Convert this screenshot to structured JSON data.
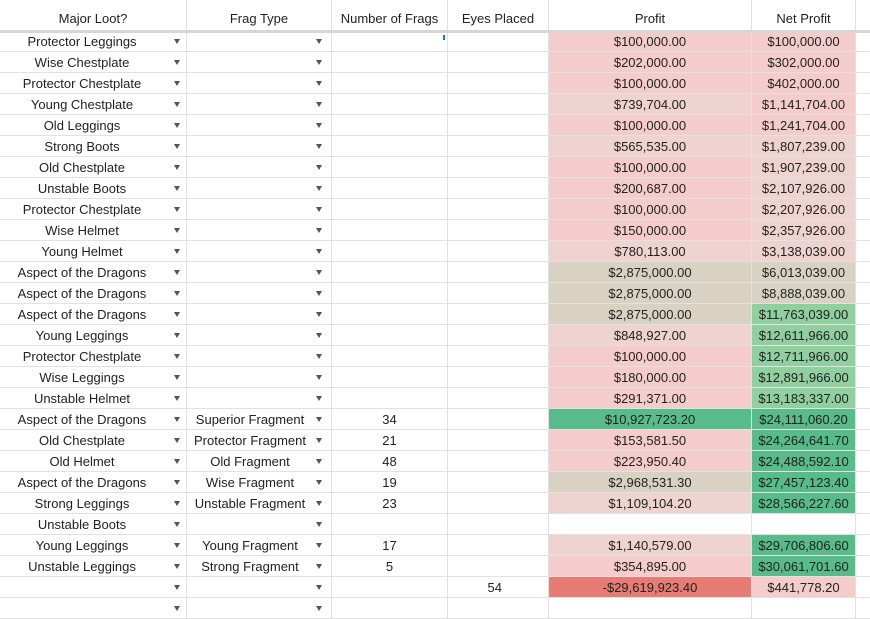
{
  "colors": {
    "pink": "#f4cccc",
    "olive": "#d9d2c3",
    "green": "#57bb8a",
    "red": "#e67c73",
    "white": "#ffffff",
    "pink_light": "#efd3d0"
  },
  "headers": {
    "major_loot": "Major Loot?",
    "frag_type": "Frag Type",
    "num_frags": "Number of Frags",
    "eyes_placed": "Eyes Placed",
    "profit": "Profit",
    "net_profit": "Net Profit"
  },
  "rows": [
    {
      "loot": "Protector Leggings",
      "frag": "",
      "num": "",
      "eyes": "",
      "profit": "$100,000.00",
      "profit_color": "pink",
      "net": "$100,000.00",
      "net_color": "pink"
    },
    {
      "loot": "Wise Chestplate",
      "frag": "",
      "num": "",
      "eyes": "",
      "profit": "$202,000.00",
      "profit_color": "pink",
      "net": "$302,000.00",
      "net_color": "pink"
    },
    {
      "loot": "Protector Chestplate",
      "frag": "",
      "num": "",
      "eyes": "",
      "profit": "$100,000.00",
      "profit_color": "pink",
      "net": "$402,000.00",
      "net_color": "pink"
    },
    {
      "loot": "Young Chestplate",
      "frag": "",
      "num": "",
      "eyes": "",
      "profit": "$739,704.00",
      "profit_color": "pink_light",
      "net": "$1,141,704.00",
      "net_color": "pink"
    },
    {
      "loot": "Old Leggings",
      "frag": "",
      "num": "",
      "eyes": "",
      "profit": "$100,000.00",
      "profit_color": "pink",
      "net": "$1,241,704.00",
      "net_color": "pink"
    },
    {
      "loot": "Strong Boots",
      "frag": "",
      "num": "",
      "eyes": "",
      "profit": "$565,535.00",
      "profit_color": "pink_light",
      "net": "$1,807,239.00",
      "net_color": "pink_light"
    },
    {
      "loot": "Old Chestplate",
      "frag": "",
      "num": "",
      "eyes": "",
      "profit": "$100,000.00",
      "profit_color": "pink",
      "net": "$1,907,239.00",
      "net_color": "pink_light"
    },
    {
      "loot": "Unstable Boots",
      "frag": "",
      "num": "",
      "eyes": "",
      "profit": "$200,687.00",
      "profit_color": "pink",
      "net": "$2,107,926.00",
      "net_color": "pink_light"
    },
    {
      "loot": "Protector Chestplate",
      "frag": "",
      "num": "",
      "eyes": "",
      "profit": "$100,000.00",
      "profit_color": "pink",
      "net": "$2,207,926.00",
      "net_color": "pink_light"
    },
    {
      "loot": "Wise Helmet",
      "frag": "",
      "num": "",
      "eyes": "",
      "profit": "$150,000.00",
      "profit_color": "pink",
      "net": "$2,357,926.00",
      "net_color": "pink_light"
    },
    {
      "loot": "Young Helmet",
      "frag": "",
      "num": "",
      "eyes": "",
      "profit": "$780,113.00",
      "profit_color": "pink_light",
      "net": "$3,138,039.00",
      "net_color": "pink_light"
    },
    {
      "loot": "Aspect of the Dragons",
      "frag": "",
      "num": "",
      "eyes": "",
      "profit": "$2,875,000.00",
      "profit_color": "olive",
      "net": "$6,013,039.00",
      "net_color": "olive"
    },
    {
      "loot": "Aspect of the Dragons",
      "frag": "",
      "num": "",
      "eyes": "",
      "profit": "$2,875,000.00",
      "profit_color": "olive",
      "net": "$8,888,039.00",
      "net_color": "olive"
    },
    {
      "loot": "Aspect of the Dragons",
      "frag": "",
      "num": "",
      "eyes": "",
      "profit": "$2,875,000.00",
      "profit_color": "olive",
      "net": "$11,763,039.00",
      "net_color": "green_soft"
    },
    {
      "loot": "Young Leggings",
      "frag": "",
      "num": "",
      "eyes": "",
      "profit": "$848,927.00",
      "profit_color": "pink_light",
      "net": "$12,611,966.00",
      "net_color": "green_soft"
    },
    {
      "loot": "Protector Chestplate",
      "frag": "",
      "num": "",
      "eyes": "",
      "profit": "$100,000.00",
      "profit_color": "pink",
      "net": "$12,711,966.00",
      "net_color": "green_soft"
    },
    {
      "loot": "Wise Leggings",
      "frag": "",
      "num": "",
      "eyes": "",
      "profit": "$180,000.00",
      "profit_color": "pink",
      "net": "$12,891,966.00",
      "net_color": "green_soft"
    },
    {
      "loot": "Unstable Helmet",
      "frag": "",
      "num": "",
      "eyes": "",
      "profit": "$291,371.00",
      "profit_color": "pink",
      "net": "$13,183,337.00",
      "net_color": "green_soft"
    },
    {
      "loot": "Aspect of the Dragons",
      "frag": "Superior Fragment",
      "num": "34",
      "eyes": "",
      "profit": "$10,927,723.20",
      "profit_color": "green",
      "net": "$24,111,060.20",
      "net_color": "green"
    },
    {
      "loot": "Old Chestplate",
      "frag": "Protector Fragment",
      "num": "21",
      "eyes": "",
      "profit": "$153,581.50",
      "profit_color": "pink",
      "net": "$24,264,641.70",
      "net_color": "green"
    },
    {
      "loot": "Old Helmet",
      "frag": "Old Fragment",
      "num": "48",
      "eyes": "",
      "profit": "$223,950.40",
      "profit_color": "pink",
      "net": "$24,488,592.10",
      "net_color": "green"
    },
    {
      "loot": "Aspect of the Dragons",
      "frag": "Wise Fragment",
      "num": "19",
      "eyes": "",
      "profit": "$2,968,531.30",
      "profit_color": "olive",
      "net": "$27,457,123.40",
      "net_color": "green"
    },
    {
      "loot": "Strong Leggings",
      "frag": "Unstable Fragment",
      "num": "23",
      "eyes": "",
      "profit": "$1,109,104.20",
      "profit_color": "pink_light",
      "net": "$28,566,227.60",
      "net_color": "green"
    },
    {
      "loot": "Unstable Boots",
      "frag": "",
      "num": "",
      "eyes": "",
      "profit": "",
      "profit_color": "white",
      "net": "",
      "net_color": "white"
    },
    {
      "loot": "Young Leggings",
      "frag": "Young Fragment",
      "num": "17",
      "eyes": "",
      "profit": "$1,140,579.00",
      "profit_color": "pink_light",
      "net": "$29,706,806.60",
      "net_color": "green"
    },
    {
      "loot": "Unstable Leggings",
      "frag": "Strong Fragment",
      "num": "5",
      "eyes": "",
      "profit": "$354,895.00",
      "profit_color": "pink",
      "net": "$30,061,701.60",
      "net_color": "green"
    },
    {
      "loot": "",
      "frag": "",
      "num": "",
      "eyes": "54",
      "profit": "-$29,619,923.40",
      "profit_color": "red",
      "net": "$441,778.20",
      "net_color": "pink"
    },
    {
      "loot": "",
      "frag": "",
      "num": "",
      "eyes": "",
      "profit": "",
      "profit_color": "white",
      "net": "",
      "net_color": "white"
    }
  ],
  "extra_colors": {
    "green_soft": "#8fcfa0"
  }
}
